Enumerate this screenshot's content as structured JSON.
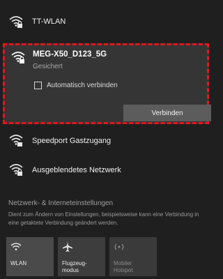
{
  "networks": {
    "n1": {
      "name": "TT-WLAN"
    },
    "n2": {
      "name": "MEG-X50_D123_5G",
      "status": "Gesichert",
      "auto_connect_label": "Automatisch verbinden",
      "auto_connect_checked": false,
      "connect_button": "Verbinden"
    },
    "n3": {
      "name": "Speedport Gastzugang"
    },
    "n4": {
      "name": "Ausgeblendetes Netzwerk"
    }
  },
  "settings": {
    "title": "Netzwerk- & Interneteinstellungen",
    "description": "Dient zum Ändern von Einstellungen, beispielsweise kann eine Verbindung in eine getaktete Verbindung geändert werden."
  },
  "quick_actions": [
    {
      "label": "WLAN",
      "icon": "wifi-icon"
    },
    {
      "label": "Flugzeug-\nmodus",
      "icon": "airplane-icon"
    },
    {
      "label": "Mobiler\nHotspot",
      "icon": "hotspot-icon"
    }
  ],
  "colors": {
    "background": "#1f1f1f",
    "selected_panel": "#353535",
    "highlight_border": "#e8141b",
    "button": "#5c5c5c"
  }
}
